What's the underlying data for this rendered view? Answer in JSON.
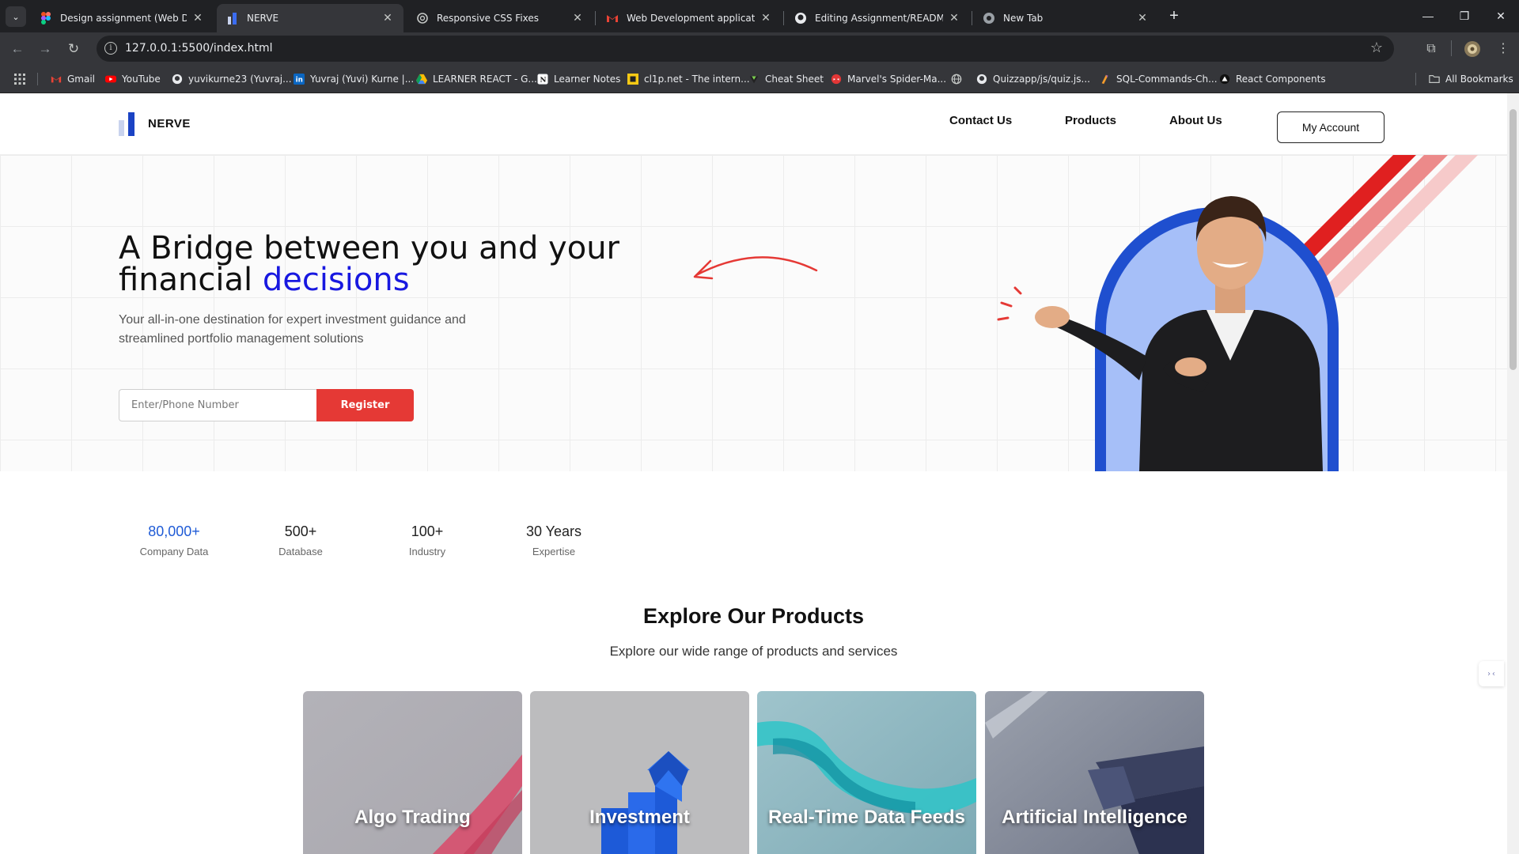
{
  "browser": {
    "tabs": [
      {
        "title": "Design assignment (Web Dev) -",
        "icon": "figma-icon"
      },
      {
        "title": "NERVE",
        "icon": "nerve-logo-icon",
        "active": true
      },
      {
        "title": "Responsive CSS Fixes",
        "icon": "openai-icon"
      },
      {
        "title": "Web Development application",
        "icon": "gmail-icon"
      },
      {
        "title": "Editing Assignment/README.m",
        "icon": "github-icon"
      },
      {
        "title": "New Tab",
        "icon": "chrome-icon"
      }
    ],
    "url": "127.0.0.1:5500/index.html",
    "bookmarks": [
      {
        "label": "Gmail",
        "icon": "gmail-icon"
      },
      {
        "label": "YouTube",
        "icon": "youtube-icon"
      },
      {
        "label": "yuvikurne23 (Yuvraj...",
        "icon": "github-icon"
      },
      {
        "label": "Yuvraj (Yuvi) Kurne |...",
        "icon": "linkedin-icon"
      },
      {
        "label": "LEARNER REACT - G...",
        "icon": "drive-icon"
      },
      {
        "label": "Learner Notes",
        "icon": "notion-icon"
      },
      {
        "label": "cl1p.net - The intern...",
        "icon": "clip-icon"
      },
      {
        "label": "Cheat Sheet",
        "icon": "cheat-sheet-icon"
      },
      {
        "label": "Marvel's Spider-Ma...",
        "icon": "spiderman-icon"
      },
      {
        "label": "",
        "icon": "globe-icon"
      },
      {
        "label": "Quizzapp/js/quiz.js...",
        "icon": "github-icon"
      },
      {
        "label": "SQL-Commands-Ch...",
        "icon": "sql-icon"
      },
      {
        "label": "React Components",
        "icon": "react-icon"
      }
    ],
    "all_bookmarks": "All Bookmarks"
  },
  "nav": {
    "logo_text": "NERVE",
    "links": [
      "Contact Us",
      "Products",
      "About Us"
    ],
    "account_label": "My Account"
  },
  "hero": {
    "title_line1": "A Bridge between you and your",
    "title_line2_plain": "financial ",
    "title_line2_accent": "decisions",
    "subtitle": "Your all-in-one destination for expert investment guidance and streamlined portfolio management solutions",
    "input_placeholder": "Enter/Phone Number",
    "register_label": "Register",
    "accent_color": "#1818e0",
    "cta_color": "#e53935"
  },
  "stats": [
    {
      "value": "80,000+",
      "label": "Company Data",
      "highlight": true
    },
    {
      "value": "500+",
      "label": "Database"
    },
    {
      "value": "100+",
      "label": "Industry"
    },
    {
      "value": "30 Years",
      "label": "Expertise"
    }
  ],
  "products": {
    "title": "Explore Our Products",
    "subtitle": "Explore our wide range of products and services",
    "cards": [
      {
        "label": "Algo Trading"
      },
      {
        "label": "Investment"
      },
      {
        "label": "Real-Time Data Feeds"
      },
      {
        "label": "Artificial Intelligence"
      }
    ]
  },
  "widget": {
    "label": "›‹"
  }
}
